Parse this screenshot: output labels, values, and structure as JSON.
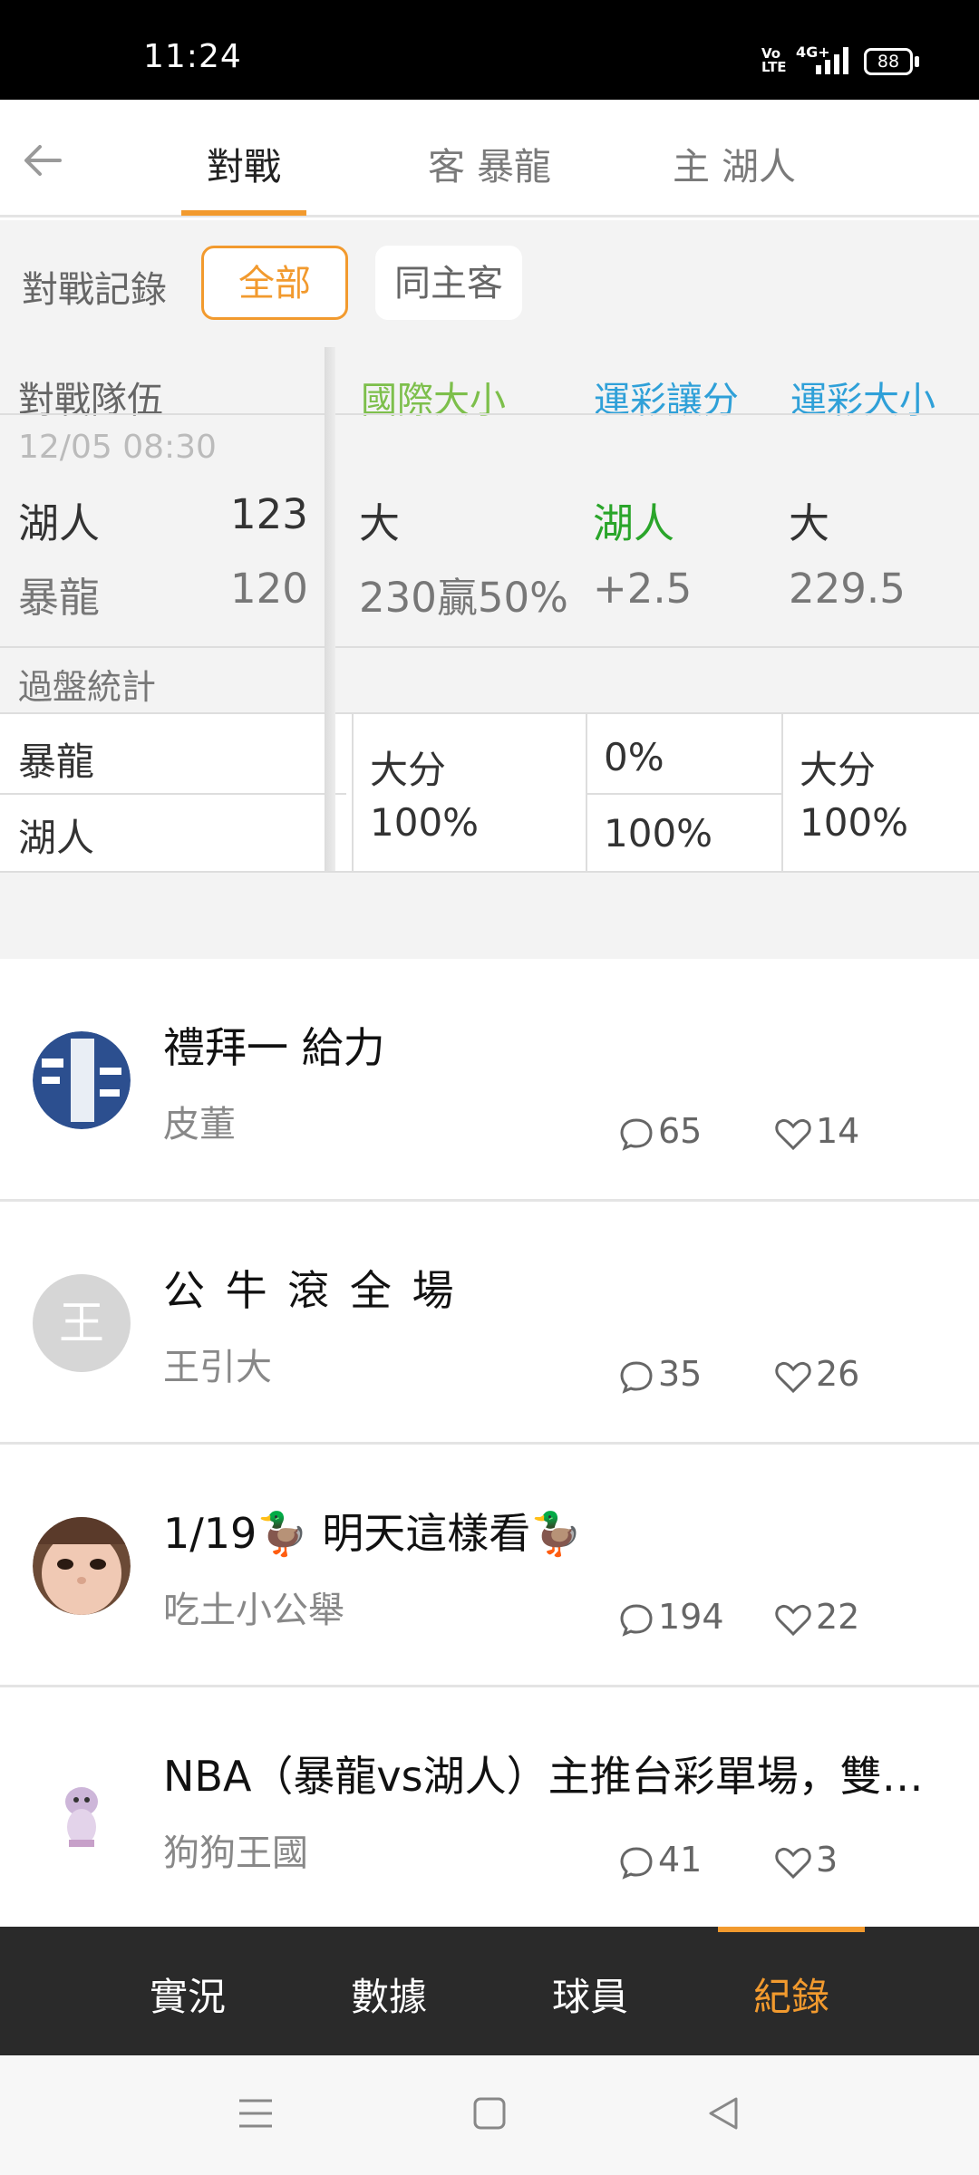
{
  "status_bar": {
    "time": "11:24",
    "volte": "Vo\nLTE",
    "network": "4G+",
    "battery": "88"
  },
  "top_tabs": [
    {
      "label": "對戰",
      "active": true
    },
    {
      "label": "客 暴龍",
      "active": false
    },
    {
      "label": "主 湖人",
      "active": false
    }
  ],
  "filter": {
    "label": "對戰記錄",
    "options": [
      "全部",
      "同主客"
    ],
    "selected": "全部"
  },
  "table": {
    "headers": {
      "team": "對戰隊伍",
      "intl_total": "國際大小",
      "spread": "運彩讓分",
      "total": "運彩大小"
    },
    "game": {
      "datetime": "12/05 08:30",
      "home_team": "湖人",
      "home_score": "123",
      "away_team": "暴龍",
      "away_score": "120",
      "intl_result": "大",
      "intl_line": "230贏50%",
      "spread_result": "湖人",
      "spread_line": "+2.5",
      "total_result": "大",
      "total_line": "229.5"
    },
    "stats": {
      "label": "過盤統計",
      "teams": [
        "暴龍",
        "湖人"
      ],
      "intl": "大分\n100%",
      "spread_top": "0%",
      "spread_bottom": "100%",
      "total": "大分\n100%"
    }
  },
  "articles": [
    {
      "title": "禮拜一 給力",
      "author": "皮董",
      "comments": "65",
      "likes": "14"
    },
    {
      "title": "公 牛 滾 全 場",
      "author": "王引大",
      "avatar_text": "王",
      "comments": "35",
      "likes": "26"
    },
    {
      "title": "1/19🦆 明天這樣看🦆",
      "author": "吃土小公舉",
      "comments": "194",
      "likes": "22"
    },
    {
      "title": "NBA（暴龍vs湖人）主推台彩單場，雙…",
      "author": "狗狗王國",
      "comments": "41",
      "likes": "3"
    }
  ],
  "bottom_tabs": [
    {
      "label": "實況",
      "active": false
    },
    {
      "label": "數據",
      "active": false
    },
    {
      "label": "球員",
      "active": false
    },
    {
      "label": "紀錄",
      "active": true
    }
  ],
  "colors": {
    "accent": "#f29a2e",
    "green_header": "#7dbf4b",
    "blue_header": "#2fa0d8",
    "team_green": "#2aa52a"
  }
}
